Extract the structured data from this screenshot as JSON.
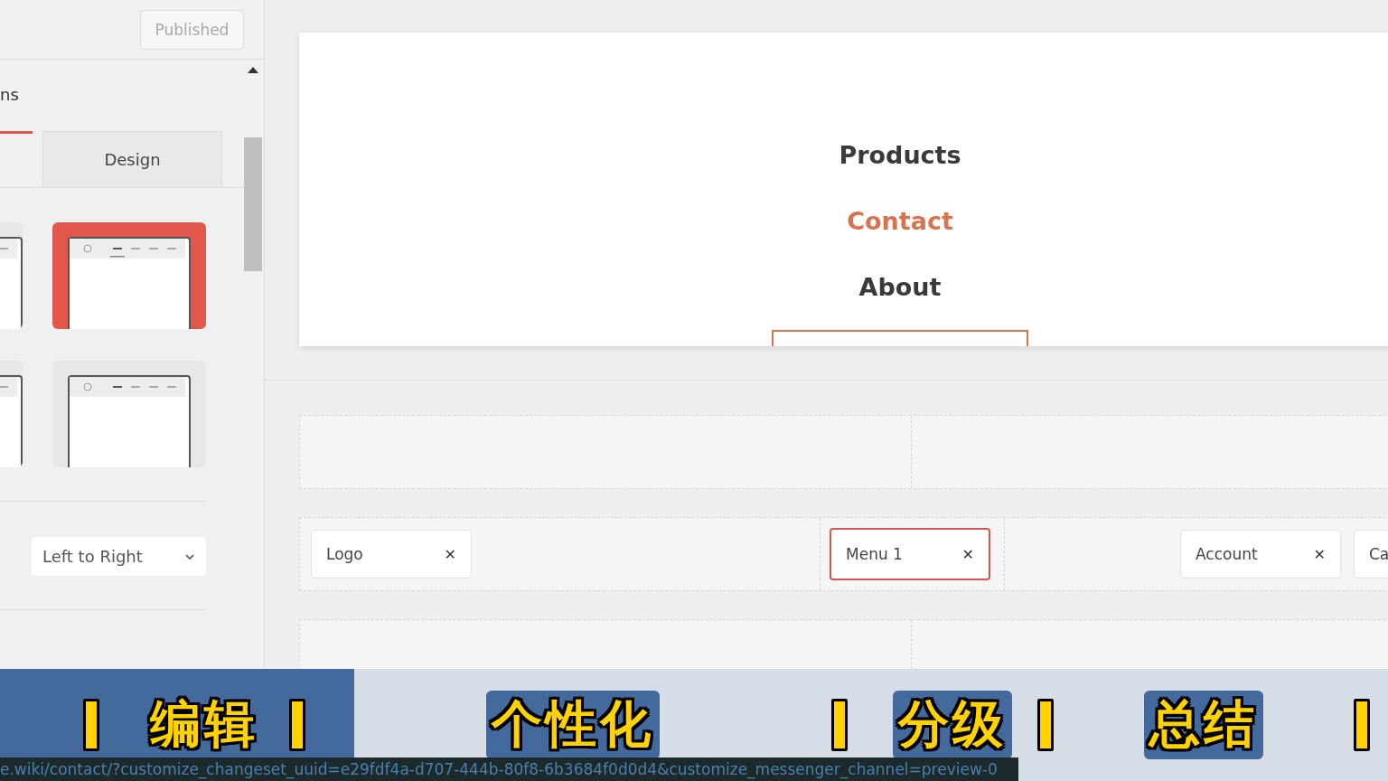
{
  "sidebar": {
    "publish_button": "Published",
    "section_title": "ns",
    "tabs": [
      {
        "selected": true
      },
      {
        "label": "Design",
        "selected": false
      }
    ],
    "layouts": [
      {
        "selected": false
      },
      {
        "selected": true
      },
      {
        "selected": false
      },
      {
        "selected": false
      }
    ],
    "direction_select": {
      "value": "Left to Right"
    }
  },
  "preview": {
    "menu": [
      {
        "label": "Products",
        "selected": false
      },
      {
        "label": "Contact",
        "selected": true
      },
      {
        "label": "About",
        "selected": false
      }
    ]
  },
  "builder": {
    "rows": [
      {},
      {
        "left": [
          {
            "label": "Logo",
            "selected": false,
            "close": "✕"
          }
        ],
        "center": [
          {
            "label": "Menu 1",
            "selected": true,
            "close": "✕"
          }
        ],
        "right": [
          {
            "label": "Account",
            "selected": false,
            "close": "✕"
          },
          {
            "label": "Ca",
            "selected": false
          }
        ]
      },
      {}
    ]
  },
  "chapter_bar": [
    {
      "kind": "separator"
    },
    {
      "kind": "label",
      "text": "编辑"
    },
    {
      "kind": "separator"
    },
    {
      "kind": "label",
      "text": "个性化"
    },
    {
      "kind": "separator"
    },
    {
      "kind": "label",
      "text": "分级"
    },
    {
      "kind": "separator"
    },
    {
      "kind": "label",
      "text": "总结"
    },
    {
      "kind": "separator"
    }
  ],
  "status_bar": {
    "url": "e.wiki/contact/?customize_changeset_uuid=e29fdf4a-d707-444b-80f8-6b3684f0d0d4&customize_messenger_channel=preview-0"
  }
}
